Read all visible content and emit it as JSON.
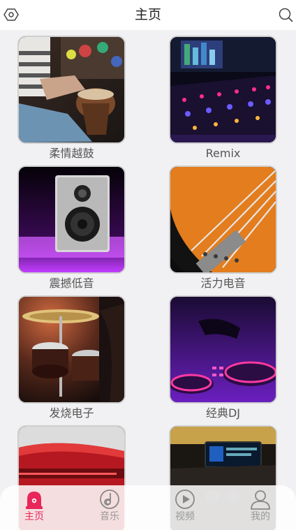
{
  "header": {
    "title": "主页",
    "left_icon": "settings-hex-icon",
    "right_icon": "search-icon"
  },
  "cards": [
    {
      "label": "柔情越鼓",
      "image": "drummer-photo"
    },
    {
      "label": "Remix",
      "image": "mixing-console-photo"
    },
    {
      "label": "震撼低音",
      "image": "speaker-photo"
    },
    {
      "label": "活力电音",
      "image": "guitar-strings-photo"
    },
    {
      "label": "发烧电子",
      "image": "drum-kit-photo"
    },
    {
      "label": "经典DJ",
      "image": "dj-deck-photo"
    },
    {
      "label": "",
      "image": "red-car-photo"
    },
    {
      "label": "",
      "image": "car-dashboard-photo"
    }
  ],
  "tabbar": {
    "items": [
      {
        "label": "主页",
        "icon": "siren-icon",
        "active": true
      },
      {
        "label": "音乐",
        "icon": "music-note-icon",
        "active": false
      },
      {
        "label": "视频",
        "icon": "play-icon",
        "active": false
      },
      {
        "label": "我的",
        "icon": "user-icon",
        "active": false
      }
    ]
  },
  "colors": {
    "accent": "#e8265a",
    "inactive": "#999999",
    "background": "#f1f1f3"
  }
}
